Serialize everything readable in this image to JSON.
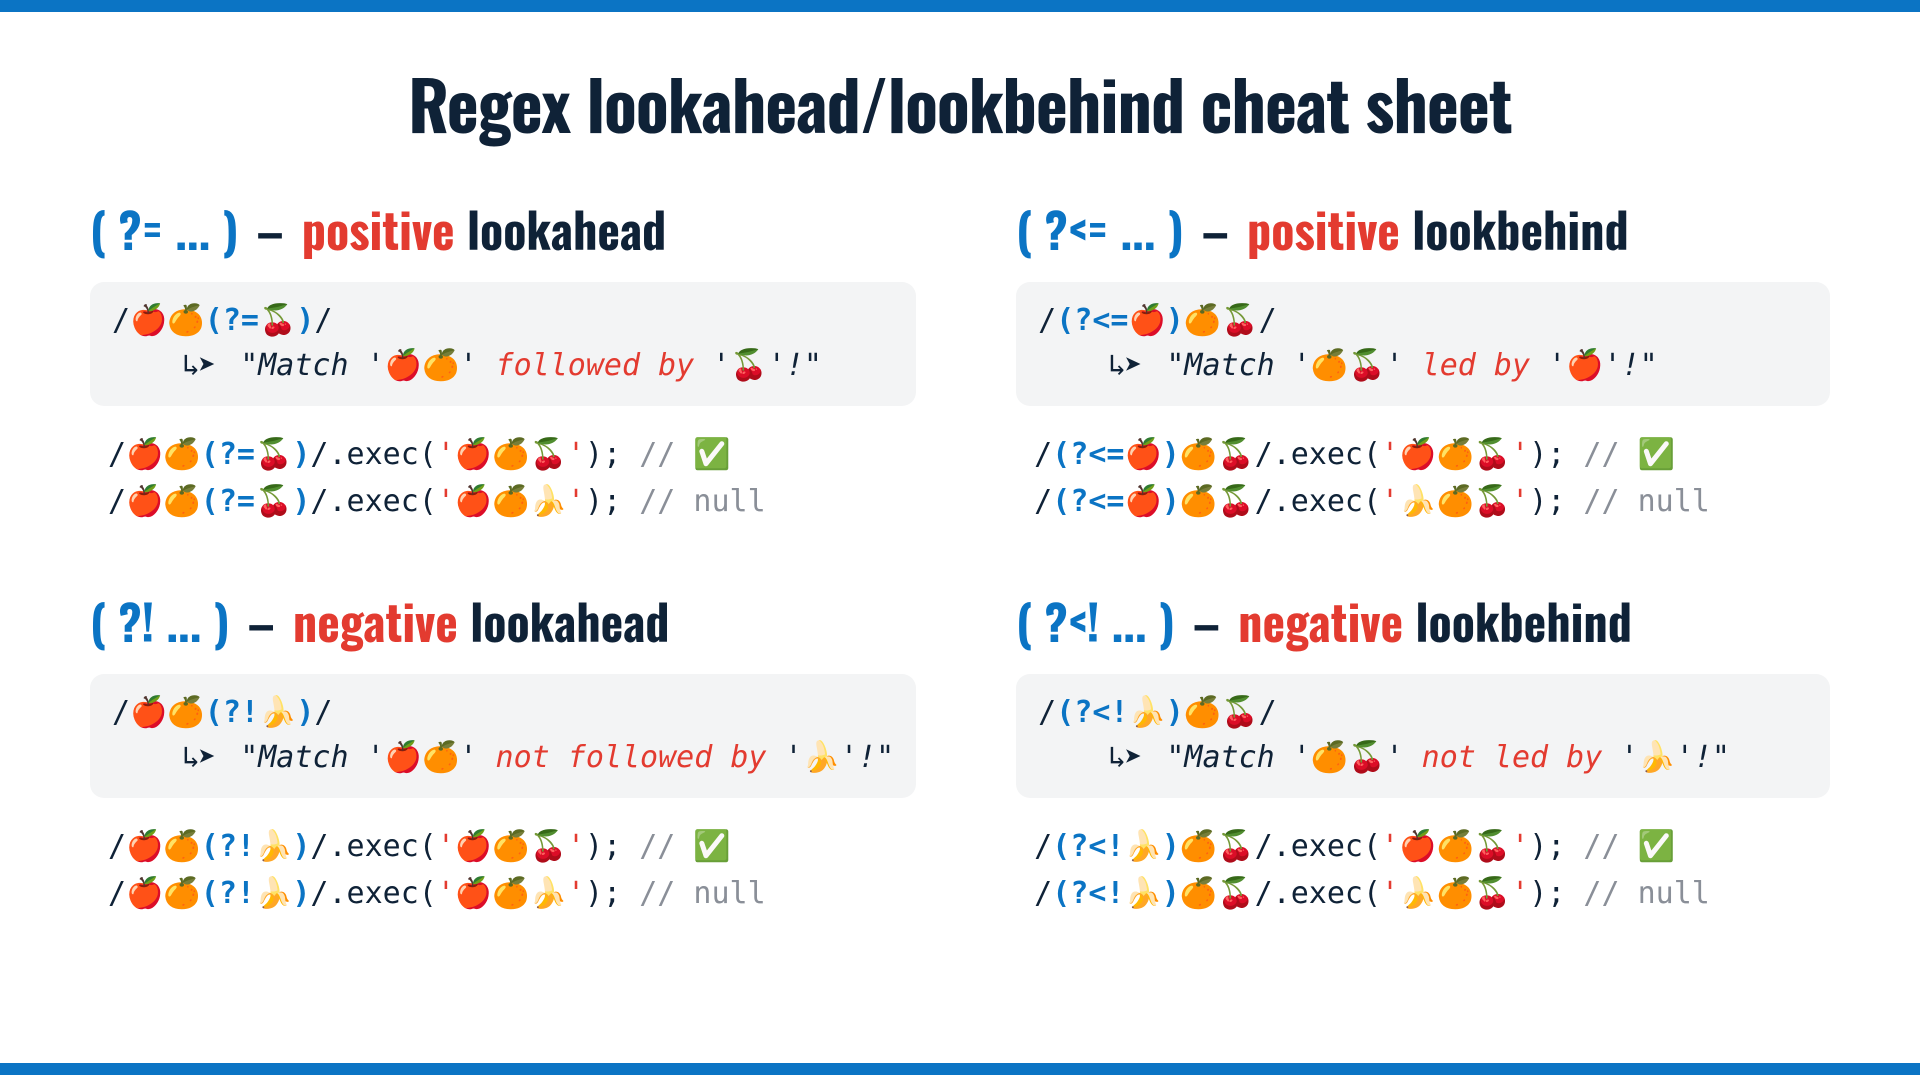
{
  "title": "Regex lookahead/lookbehind cheat sheet",
  "emoji": {
    "apple": "🍎",
    "orange": "🍊",
    "cherry": "🍒",
    "banana": "🍌",
    "check": "✅"
  },
  "arrow": "↳➤",
  "quads": {
    "pos_ahead": {
      "syntax": "( ?= ... )",
      "dash": "–",
      "qualifier": "positive",
      "kind": "lookahead",
      "pattern_pre": "/",
      "pattern_body": "🍎🍊",
      "pattern_look": "(?=🍒)",
      "pattern_post": "/",
      "desc_pre": "\"Match '",
      "desc_target": "🍎🍊",
      "desc_mid1": "' ",
      "desc_red": "followed by",
      "desc_mid2": " '",
      "desc_tail": "🍒",
      "desc_post": "'!\"",
      "ex1_pre": "/",
      "ex1_body": "🍎🍊",
      "ex1_look": "(?=🍒)",
      "ex1_mid": "/.exec(",
      "ex1_str": "'🍎🍊🍒'",
      "ex1_close": "); ",
      "ex1_cmt": "//",
      "ex1_res": " ✅",
      "ex2_pre": "/",
      "ex2_body": "🍎🍊",
      "ex2_look": "(?=🍒)",
      "ex2_mid": "/.exec(",
      "ex2_str": "'🍎🍊🍌'",
      "ex2_close": "); ",
      "ex2_cmt": "// null"
    },
    "pos_behind": {
      "syntax": "( ?<= ... )",
      "dash": "–",
      "qualifier": "positive",
      "kind": "lookbehind",
      "pattern_pre": "/",
      "pattern_look": "(?<=🍎)",
      "pattern_body": "🍊🍒",
      "pattern_post": "/",
      "desc_pre": "\"Match '",
      "desc_target": "🍊🍒",
      "desc_mid1": "' ",
      "desc_red": "led by",
      "desc_mid2": " '",
      "desc_tail": "🍎",
      "desc_post": "'!\"",
      "ex1_pre": "/",
      "ex1_look": "(?<=🍎)",
      "ex1_body": "🍊🍒",
      "ex1_mid": "/.exec(",
      "ex1_str": "'🍎🍊🍒'",
      "ex1_close": "); ",
      "ex1_cmt": "//",
      "ex1_res": " ✅",
      "ex2_pre": "/",
      "ex2_look": "(?<=🍎)",
      "ex2_body": "🍊🍒",
      "ex2_mid": "/.exec(",
      "ex2_str": "'🍌🍊🍒'",
      "ex2_close": "); ",
      "ex2_cmt": "// null"
    },
    "neg_ahead": {
      "syntax": "( ?! ... )",
      "dash": "–",
      "qualifier": "negative",
      "kind": "lookahead",
      "pattern_pre": "/",
      "pattern_body": "🍎🍊",
      "pattern_look": "(?!🍌)",
      "pattern_post": "/",
      "desc_pre": "\"Match '",
      "desc_target": "🍎🍊",
      "desc_mid1": "' ",
      "desc_red": "not followed by",
      "desc_mid2": " '",
      "desc_tail": "🍌",
      "desc_post": "'!\"",
      "ex1_pre": "/",
      "ex1_body": "🍎🍊",
      "ex1_look": "(?!🍌)",
      "ex1_mid": "/.exec(",
      "ex1_str": "'🍎🍊🍒'",
      "ex1_close": "); ",
      "ex1_cmt": "//",
      "ex1_res": " ✅",
      "ex2_pre": "/",
      "ex2_body": "🍎🍊",
      "ex2_look": "(?!🍌)",
      "ex2_mid": "/.exec(",
      "ex2_str": "'🍎🍊🍌'",
      "ex2_close": "); ",
      "ex2_cmt": "// null"
    },
    "neg_behind": {
      "syntax": "( ?<! ... )",
      "dash": "–",
      "qualifier": "negative",
      "kind": "lookbehind",
      "pattern_pre": "/",
      "pattern_look": "(?<!🍌)",
      "pattern_body": "🍊🍒",
      "pattern_post": "/",
      "desc_pre": "\"Match '",
      "desc_target": "🍊🍒",
      "desc_mid1": "' ",
      "desc_red": "not led by",
      "desc_mid2": " '",
      "desc_tail": "🍌",
      "desc_post": "'!\"",
      "ex1_pre": "/",
      "ex1_look": "(?<!🍌)",
      "ex1_body": "🍊🍒",
      "ex1_mid": "/.exec(",
      "ex1_str": "'🍎🍊🍒'",
      "ex1_close": "); ",
      "ex1_cmt": "//",
      "ex1_res": " ✅",
      "ex2_pre": "/",
      "ex2_look": "(?<!🍌)",
      "ex2_body": "🍊🍒",
      "ex2_mid": "/.exec(",
      "ex2_str": "'🍌🍊🍒'",
      "ex2_close": "); ",
      "ex2_cmt": "// null"
    }
  }
}
